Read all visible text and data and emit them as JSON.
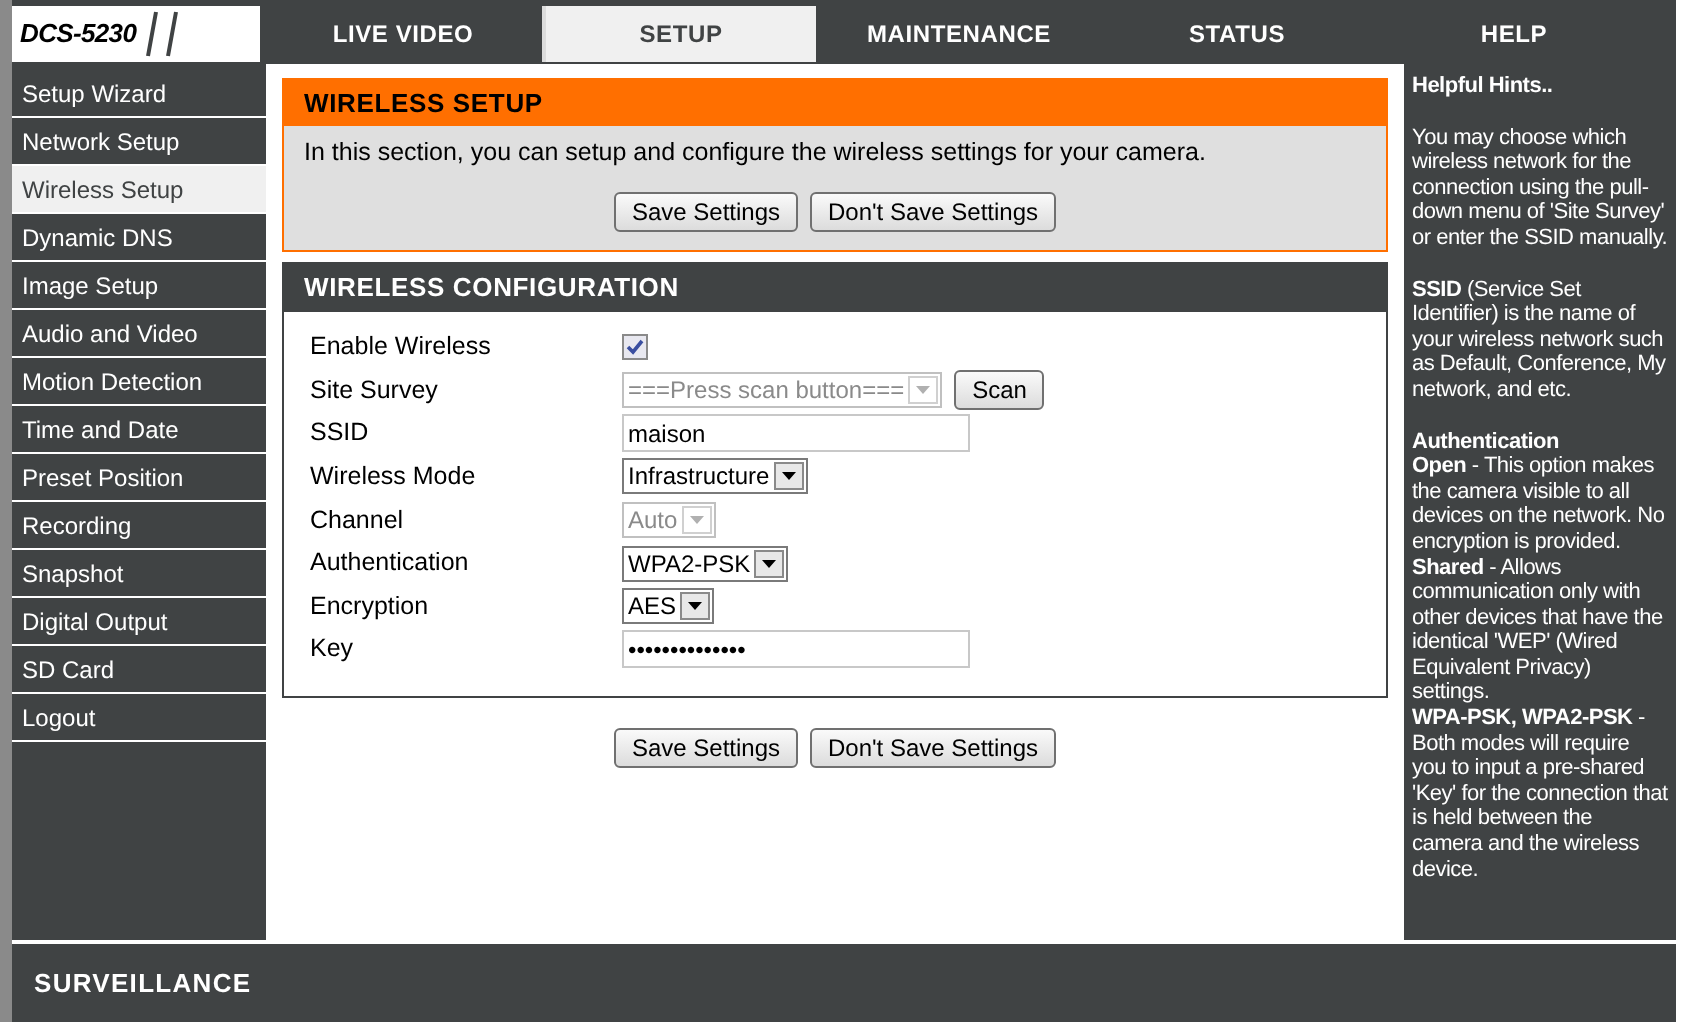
{
  "brand": "DCS-5230",
  "tabs": [
    {
      "label": "LIVE VIDEO",
      "selected": false
    },
    {
      "label": "SETUP",
      "selected": true
    },
    {
      "label": "MAINTENANCE",
      "selected": false
    },
    {
      "label": "STATUS",
      "selected": false
    },
    {
      "label": "HELP",
      "selected": false
    }
  ],
  "sidebar": {
    "items": [
      {
        "label": "Setup Wizard",
        "selected": false
      },
      {
        "label": "Network Setup",
        "selected": false
      },
      {
        "label": "Wireless Setup",
        "selected": true
      },
      {
        "label": "Dynamic DNS",
        "selected": false
      },
      {
        "label": "Image Setup",
        "selected": false
      },
      {
        "label": "Audio and Video",
        "selected": false
      },
      {
        "label": "Motion Detection",
        "selected": false
      },
      {
        "label": "Time and Date",
        "selected": false
      },
      {
        "label": "Preset Position",
        "selected": false
      },
      {
        "label": "Recording",
        "selected": false
      },
      {
        "label": "Snapshot",
        "selected": false
      },
      {
        "label": "Digital Output",
        "selected": false
      },
      {
        "label": "SD Card",
        "selected": false
      },
      {
        "label": "Logout",
        "selected": false
      }
    ]
  },
  "wireless_setup": {
    "title": "WIRELESS SETUP",
    "description": "In this section, you can setup and configure the wireless settings for your camera.",
    "buttons": [
      "Save Settings",
      "Don't Save Settings"
    ]
  },
  "wireless_configuration": {
    "title": "WIRELESS CONFIGURATION",
    "fields": [
      {
        "label": "Enable Wireless",
        "kind": "checkbox",
        "checked": true
      },
      {
        "label": "Site Survey",
        "kind": "select",
        "value": "===Press scan button===",
        "disabled": true,
        "button": "Scan"
      },
      {
        "label": "SSID",
        "kind": "text",
        "value": "maison"
      },
      {
        "label": "Wireless Mode",
        "kind": "select",
        "value": "Infrastructure",
        "disabled": false
      },
      {
        "label": "Channel",
        "kind": "select",
        "value": "Auto",
        "disabled": true
      },
      {
        "label": "Authentication",
        "kind": "select",
        "value": "WPA2-PSK",
        "disabled": false
      },
      {
        "label": "Encryption",
        "kind": "select",
        "value": "AES",
        "disabled": false
      },
      {
        "label": "Key",
        "kind": "text",
        "value": "••••••••••••••"
      }
    ]
  },
  "bottom_buttons": [
    "Save Settings",
    "Don't Save Settings"
  ],
  "hints": {
    "title": "Helpful Hints..",
    "paragraphs": [
      {
        "lines": [
          "You may choose which wireless network for the connection using the pull-down menu of 'Site Survey' or enter the SSID manually."
        ]
      },
      {
        "lines": [
          "**SSID** (Service Set Identifier) is the name of your wireless network such as Default, Conference, My network, and etc."
        ]
      },
      {
        "heading": "Authentication",
        "lines": [
          "**Open** - This option makes the camera visible to all devices on the network. No encryption is provided.",
          "**Shared** - Allows communication only with other devices that have the identical 'WEP' (Wired Equivalent Privacy) settings.",
          "**WPA-PSK, WPA2-PSK** - Both modes will require you to input a pre-shared 'Key' for the connection that is held between the camera and the wireless device."
        ]
      }
    ]
  },
  "footer": {
    "title": "SURVEILLANCE"
  }
}
